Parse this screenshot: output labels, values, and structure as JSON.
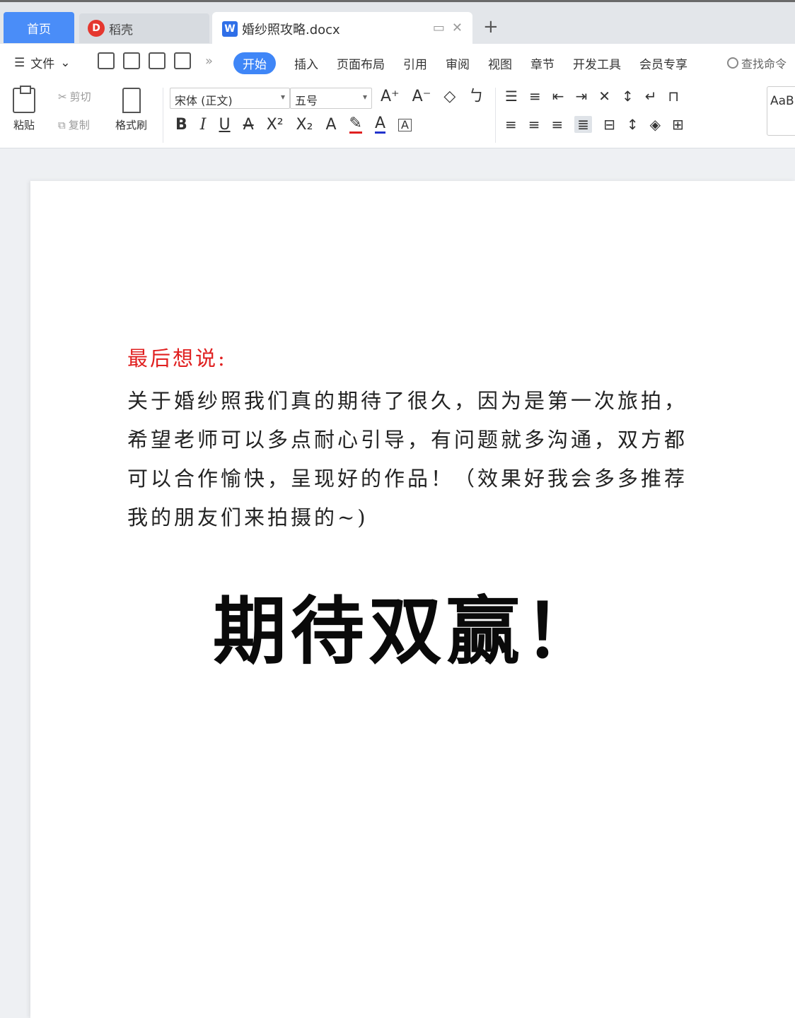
{
  "tabs": {
    "home": "首页",
    "daoke": "稻壳",
    "document": "婚纱照攻略.docx"
  },
  "menu": {
    "file": "文件",
    "tabs": [
      "开始",
      "插入",
      "页面布局",
      "引用",
      "审阅",
      "视图",
      "章节",
      "开发工具",
      "会员专享"
    ],
    "search": "查找命令"
  },
  "toolbar": {
    "paste": "粘贴",
    "cut": "剪切",
    "copy": "复制",
    "format_painter": "格式刷",
    "font_name": "宋体 (正文)",
    "font_size": "五号",
    "style_preview": "AaBl"
  },
  "document": {
    "heading": "最后想说:",
    "lines": [
      "关于婚纱照我们真的期待了很久，因为是第一次旅拍，",
      "希望老师可以多点耐心引导，有问题就多沟通，双方都",
      "可以合作愉快，呈现好的作品！（效果好我会多多推荐",
      "我的朋友们来拍摄的~)"
    ],
    "big_title": "期待双赢！"
  },
  "colors": {
    "accent": "#3f86f7",
    "heading_red": "#e02020"
  }
}
